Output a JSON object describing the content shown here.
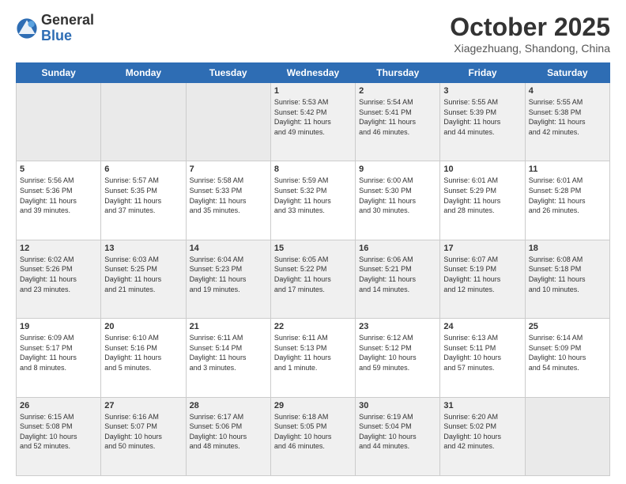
{
  "logo": {
    "general": "General",
    "blue": "Blue"
  },
  "header": {
    "month": "October 2025",
    "location": "Xiagezhuang, Shandong, China"
  },
  "weekdays": [
    "Sunday",
    "Monday",
    "Tuesday",
    "Wednesday",
    "Thursday",
    "Friday",
    "Saturday"
  ],
  "weeks": [
    [
      {
        "day": "",
        "text": ""
      },
      {
        "day": "",
        "text": ""
      },
      {
        "day": "",
        "text": ""
      },
      {
        "day": "1",
        "text": "Sunrise: 5:53 AM\nSunset: 5:42 PM\nDaylight: 11 hours\nand 49 minutes."
      },
      {
        "day": "2",
        "text": "Sunrise: 5:54 AM\nSunset: 5:41 PM\nDaylight: 11 hours\nand 46 minutes."
      },
      {
        "day": "3",
        "text": "Sunrise: 5:55 AM\nSunset: 5:39 PM\nDaylight: 11 hours\nand 44 minutes."
      },
      {
        "day": "4",
        "text": "Sunrise: 5:55 AM\nSunset: 5:38 PM\nDaylight: 11 hours\nand 42 minutes."
      }
    ],
    [
      {
        "day": "5",
        "text": "Sunrise: 5:56 AM\nSunset: 5:36 PM\nDaylight: 11 hours\nand 39 minutes."
      },
      {
        "day": "6",
        "text": "Sunrise: 5:57 AM\nSunset: 5:35 PM\nDaylight: 11 hours\nand 37 minutes."
      },
      {
        "day": "7",
        "text": "Sunrise: 5:58 AM\nSunset: 5:33 PM\nDaylight: 11 hours\nand 35 minutes."
      },
      {
        "day": "8",
        "text": "Sunrise: 5:59 AM\nSunset: 5:32 PM\nDaylight: 11 hours\nand 33 minutes."
      },
      {
        "day": "9",
        "text": "Sunrise: 6:00 AM\nSunset: 5:30 PM\nDaylight: 11 hours\nand 30 minutes."
      },
      {
        "day": "10",
        "text": "Sunrise: 6:01 AM\nSunset: 5:29 PM\nDaylight: 11 hours\nand 28 minutes."
      },
      {
        "day": "11",
        "text": "Sunrise: 6:01 AM\nSunset: 5:28 PM\nDaylight: 11 hours\nand 26 minutes."
      }
    ],
    [
      {
        "day": "12",
        "text": "Sunrise: 6:02 AM\nSunset: 5:26 PM\nDaylight: 11 hours\nand 23 minutes."
      },
      {
        "day": "13",
        "text": "Sunrise: 6:03 AM\nSunset: 5:25 PM\nDaylight: 11 hours\nand 21 minutes."
      },
      {
        "day": "14",
        "text": "Sunrise: 6:04 AM\nSunset: 5:23 PM\nDaylight: 11 hours\nand 19 minutes."
      },
      {
        "day": "15",
        "text": "Sunrise: 6:05 AM\nSunset: 5:22 PM\nDaylight: 11 hours\nand 17 minutes."
      },
      {
        "day": "16",
        "text": "Sunrise: 6:06 AM\nSunset: 5:21 PM\nDaylight: 11 hours\nand 14 minutes."
      },
      {
        "day": "17",
        "text": "Sunrise: 6:07 AM\nSunset: 5:19 PM\nDaylight: 11 hours\nand 12 minutes."
      },
      {
        "day": "18",
        "text": "Sunrise: 6:08 AM\nSunset: 5:18 PM\nDaylight: 11 hours\nand 10 minutes."
      }
    ],
    [
      {
        "day": "19",
        "text": "Sunrise: 6:09 AM\nSunset: 5:17 PM\nDaylight: 11 hours\nand 8 minutes."
      },
      {
        "day": "20",
        "text": "Sunrise: 6:10 AM\nSunset: 5:16 PM\nDaylight: 11 hours\nand 5 minutes."
      },
      {
        "day": "21",
        "text": "Sunrise: 6:11 AM\nSunset: 5:14 PM\nDaylight: 11 hours\nand 3 minutes."
      },
      {
        "day": "22",
        "text": "Sunrise: 6:11 AM\nSunset: 5:13 PM\nDaylight: 11 hours\nand 1 minute."
      },
      {
        "day": "23",
        "text": "Sunrise: 6:12 AM\nSunset: 5:12 PM\nDaylight: 10 hours\nand 59 minutes."
      },
      {
        "day": "24",
        "text": "Sunrise: 6:13 AM\nSunset: 5:11 PM\nDaylight: 10 hours\nand 57 minutes."
      },
      {
        "day": "25",
        "text": "Sunrise: 6:14 AM\nSunset: 5:09 PM\nDaylight: 10 hours\nand 54 minutes."
      }
    ],
    [
      {
        "day": "26",
        "text": "Sunrise: 6:15 AM\nSunset: 5:08 PM\nDaylight: 10 hours\nand 52 minutes."
      },
      {
        "day": "27",
        "text": "Sunrise: 6:16 AM\nSunset: 5:07 PM\nDaylight: 10 hours\nand 50 minutes."
      },
      {
        "day": "28",
        "text": "Sunrise: 6:17 AM\nSunset: 5:06 PM\nDaylight: 10 hours\nand 48 minutes."
      },
      {
        "day": "29",
        "text": "Sunrise: 6:18 AM\nSunset: 5:05 PM\nDaylight: 10 hours\nand 46 minutes."
      },
      {
        "day": "30",
        "text": "Sunrise: 6:19 AM\nSunset: 5:04 PM\nDaylight: 10 hours\nand 44 minutes."
      },
      {
        "day": "31",
        "text": "Sunrise: 6:20 AM\nSunset: 5:02 PM\nDaylight: 10 hours\nand 42 minutes."
      },
      {
        "day": "",
        "text": ""
      }
    ]
  ]
}
